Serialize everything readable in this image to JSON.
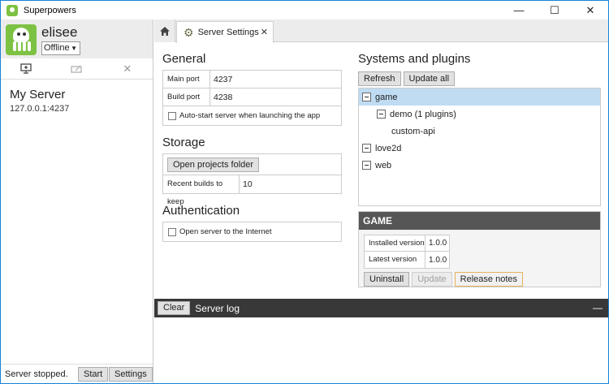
{
  "window": {
    "title": "Superpowers",
    "controls": {
      "minimize": "—",
      "maximize": "☐",
      "close": "✕"
    }
  },
  "user": {
    "name": "elisee",
    "status": "Offline"
  },
  "sidebar": {
    "tools": [
      {
        "icon": "connect-server-icon"
      },
      {
        "icon": "edit-server-icon"
      },
      {
        "icon": "remove-server-icon"
      }
    ],
    "servers": [
      {
        "name": "My Server",
        "address": "127.0.0.1:4237"
      }
    ],
    "footer": {
      "status": "Server stopped.",
      "start_label": "Start",
      "settings_label": "Settings"
    }
  },
  "tabs": {
    "home_icon": "home-icon",
    "settings": {
      "label": "Server Settings",
      "close": "✕"
    }
  },
  "general": {
    "title": "General",
    "main_port_label": "Main port",
    "main_port": "4237",
    "build_port_label": "Build port",
    "build_port": "4238",
    "autostart_label": "Auto-start server when launching the app",
    "autostart": false
  },
  "storage": {
    "title": "Storage",
    "open_folder_label": "Open projects folder",
    "recent_builds_label": "Recent builds to keep",
    "recent_builds": "10"
  },
  "authentication": {
    "title": "Authentication",
    "open_internet_label": "Open server to the Internet",
    "open_internet": false
  },
  "systems": {
    "title": "Systems and plugins",
    "refresh_label": "Refresh",
    "update_all_label": "Update all",
    "tree": [
      {
        "label": "game",
        "depth": 0,
        "expandable": true,
        "selected": true
      },
      {
        "label": "demo (1 plugins)",
        "depth": 1,
        "expandable": true,
        "selected": false
      },
      {
        "label": "custom-api",
        "depth": 2,
        "expandable": false,
        "selected": false
      },
      {
        "label": "love2d",
        "depth": 0,
        "expandable": true,
        "selected": false
      },
      {
        "label": "web",
        "depth": 0,
        "expandable": true,
        "selected": false
      }
    ]
  },
  "game_panel": {
    "title": "GAME",
    "installed_label": "Installed version",
    "installed": "1.0.0",
    "latest_label": "Latest version",
    "latest": "1.0.0",
    "uninstall_label": "Uninstall",
    "update_label": "Update",
    "release_notes_label": "Release notes"
  },
  "log": {
    "clear_label": "Clear",
    "title": "Server log",
    "collapse": "—"
  },
  "colors": {
    "selection": "#c0dcf3",
    "log_bar": "#383838",
    "game_header": "#565656",
    "brand_green": "#7dc242"
  }
}
